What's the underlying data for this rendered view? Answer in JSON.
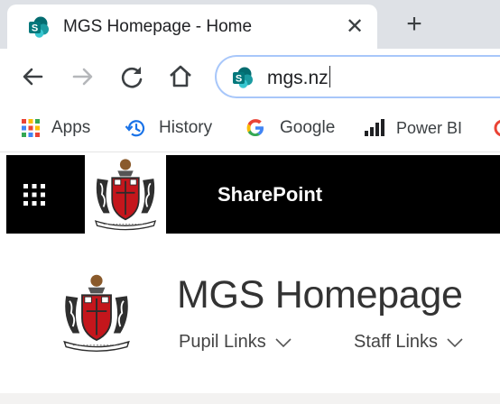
{
  "browser": {
    "tab": {
      "title": "MGS Homepage - Home",
      "favicon": "sharepoint-icon",
      "close_glyph": "✕"
    },
    "new_tab_glyph": "+",
    "address": {
      "url": "mgs.nz",
      "favicon": "sharepoint-icon"
    },
    "nav_icons": [
      "back-arrow-icon",
      "forward-arrow-icon",
      "reload-icon",
      "home-icon"
    ],
    "bookmarks": [
      {
        "label": "Apps",
        "icon": "apps-grid-icon"
      },
      {
        "label": "History",
        "icon": "history-icon"
      },
      {
        "label": "Google",
        "icon": "google-icon"
      },
      {
        "label": "Power BI",
        "icon": "powerbi-icon"
      }
    ]
  },
  "suite_bar": {
    "title": "SharePoint",
    "icon": "app-launcher-icon"
  },
  "site": {
    "title": "MGS Homepage",
    "nav": [
      {
        "label": "Pupil Links"
      },
      {
        "label": "Staff Links"
      }
    ]
  },
  "colors": {
    "tab_strip": "#dee1e6",
    "sharepoint_teal": "#036c70",
    "suite_bar": "#000000",
    "omnibox_focus": "#a8c7fa",
    "crest_red": "#c4161c"
  }
}
